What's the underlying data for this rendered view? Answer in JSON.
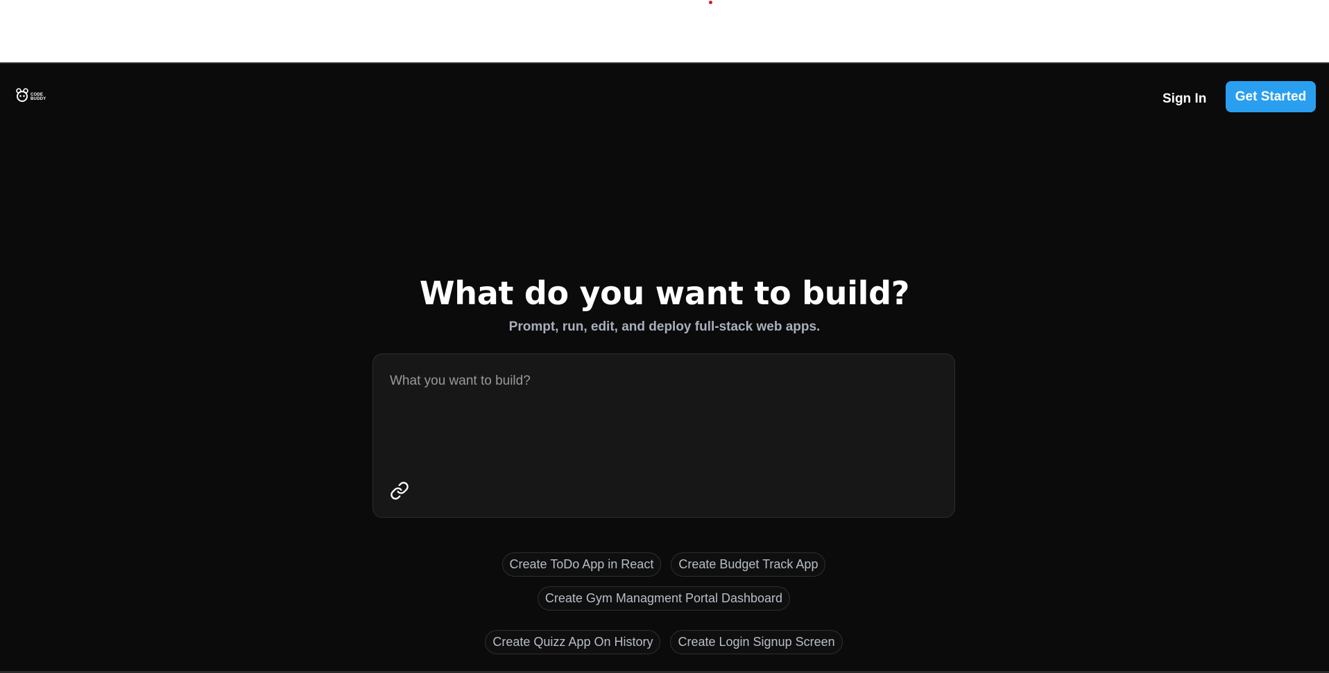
{
  "header": {
    "logo_line1": "CODE",
    "logo_line2": "BUDDY",
    "sign_in_label": "Sign In",
    "get_started_label": "Get Started",
    "accent_color": "#2a9ff0"
  },
  "hero": {
    "title": "What do you want to build?",
    "subtitle": "Prompt, run, edit, and deploy full-stack web apps."
  },
  "prompt": {
    "placeholder": "What you want to build?",
    "value": "",
    "attach_icon": "link-icon"
  },
  "suggestions": [
    "Create ToDo App in React",
    "Create Budget Track App",
    "Create Gym Managment Portal Dashboard",
    "Create Quizz App On History",
    "Create Login Signup Screen"
  ]
}
